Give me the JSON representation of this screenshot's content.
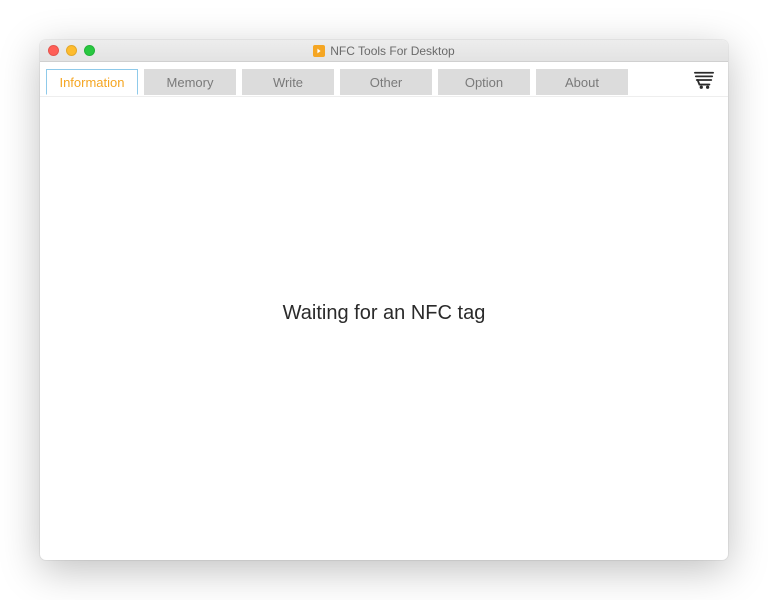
{
  "window": {
    "title": "NFC Tools For Desktop"
  },
  "tabs": [
    {
      "label": "Information",
      "active": true
    },
    {
      "label": "Memory",
      "active": false
    },
    {
      "label": "Write",
      "active": false
    },
    {
      "label": "Other",
      "active": false
    },
    {
      "label": "Option",
      "active": false
    },
    {
      "label": "About",
      "active": false
    }
  ],
  "main": {
    "status": "Waiting for an NFC tag"
  },
  "icons": {
    "app": "nfc-app-icon",
    "cart": "shopping-cart-icon"
  }
}
